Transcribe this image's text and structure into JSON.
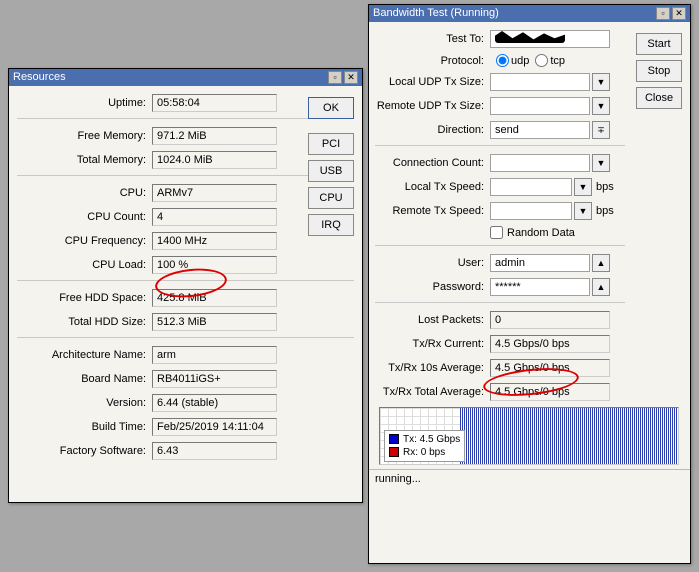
{
  "resources": {
    "title": "Resources",
    "rows": {
      "uptime_label": "Uptime:",
      "uptime": "05:58:04",
      "freemem_label": "Free Memory:",
      "freemem": "971.2 MiB",
      "totmem_label": "Total Memory:",
      "totmem": "1024.0 MiB",
      "cpu_label": "CPU:",
      "cpu": "ARMv7",
      "cpucount_label": "CPU Count:",
      "cpucount": "4",
      "cpufreq_label": "CPU Frequency:",
      "cpufreq": "1400 MHz",
      "cpuload_label": "CPU Load:",
      "cpuload": "100 %",
      "freehdd_label": "Free HDD Space:",
      "freehdd": "425.8 MiB",
      "tothdd_label": "Total HDD Size:",
      "tothdd": "512.3 MiB",
      "arch_label": "Architecture Name:",
      "arch": "arm",
      "board_label": "Board Name:",
      "board": "RB4011iGS+",
      "version_label": "Version:",
      "version": "6.44 (stable)",
      "buildtime_label": "Build Time:",
      "buildtime": "Feb/25/2019 14:11:04",
      "factory_label": "Factory Software:",
      "factory": "6.43"
    },
    "buttons": {
      "ok": "OK",
      "pci": "PCI",
      "usb": "USB",
      "cpu": "CPU",
      "irq": "IRQ"
    }
  },
  "bandwidth": {
    "title": "Bandwidth Test (Running)",
    "labels": {
      "testto": "Test To:",
      "protocol": "Protocol:",
      "udp": "udp",
      "tcp": "tcp",
      "localudp": "Local UDP Tx Size:",
      "remoteudp": "Remote UDP Tx Size:",
      "direction": "Direction:",
      "direction_val": "send",
      "conncount": "Connection Count:",
      "localtx": "Local Tx Speed:",
      "bps": "bps",
      "remotetx": "Remote Tx Speed:",
      "randomdata": "Random Data",
      "user": "User:",
      "user_val": "admin",
      "password": "Password:",
      "password_val": "******",
      "lost": "Lost Packets:",
      "lost_val": "0",
      "txrxcur": "Tx/Rx Current:",
      "txrxcur_val": "4.5 Gbps/0 bps",
      "txrx10s": "Tx/Rx 10s Average:",
      "txrx10s_val": "4.5 Gbps/0 bps",
      "txrxtot": "Tx/Rx Total Average:",
      "txrxtot_val": "4.5 Gbps/0 bps",
      "legend_tx": "Tx:  4.5 Gbps",
      "legend_rx": "Rx:  0 bps",
      "status": "running..."
    },
    "buttons": {
      "start": "Start",
      "stop": "Stop",
      "close": "Close"
    }
  }
}
